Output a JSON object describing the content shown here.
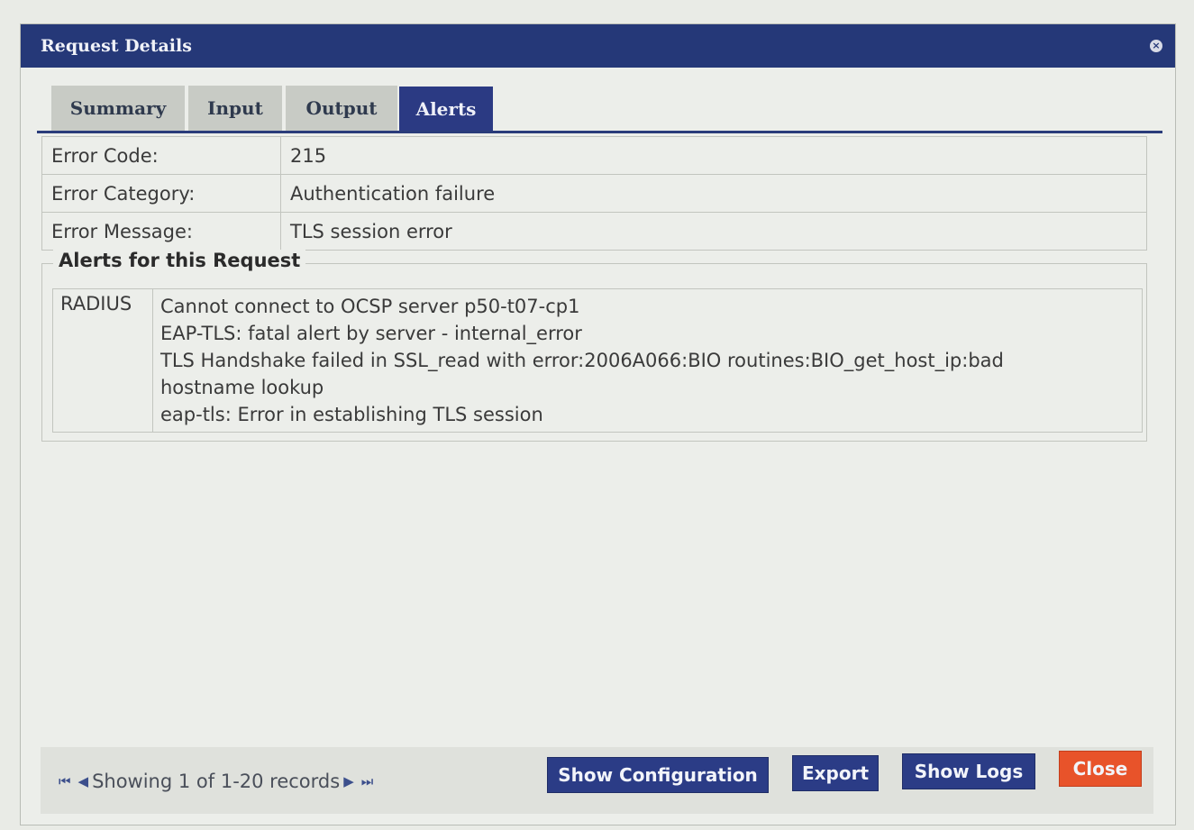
{
  "dialog": {
    "title": "Request Details",
    "close_icon": "×"
  },
  "tabs": [
    {
      "label": "Summary",
      "active": false
    },
    {
      "label": "Input",
      "active": false
    },
    {
      "label": "Output",
      "active": false
    },
    {
      "label": "Alerts",
      "active": true
    }
  ],
  "error": {
    "rows": [
      {
        "label": "Error Code:",
        "value": "215"
      },
      {
        "label": "Error Category:",
        "value": "Authentication failure"
      },
      {
        "label": "Error Message:",
        "value": "TLS session error"
      }
    ]
  },
  "alerts": {
    "legend": "Alerts for this Request",
    "source": "RADIUS",
    "lines": [
      "Cannot connect to OCSP server p50-t07-cp1",
      "EAP-TLS: fatal alert by server - internal_error",
      "TLS Handshake failed in SSL_read with error:2006A066:BIO routines:BIO_get_host_ip:bad",
      "hostname lookup",
      "eap-tls: Error in establishing TLS session"
    ]
  },
  "footer": {
    "pager_text": "Showing 1 of 1-20 records",
    "buttons": {
      "show_configuration": "Show Configuration",
      "export": "Export",
      "show_logs": "Show Logs",
      "close": "Close"
    }
  },
  "colors": {
    "title_bar": "#253878",
    "accent": "#2b3c86",
    "close_button": "#e8532a"
  }
}
